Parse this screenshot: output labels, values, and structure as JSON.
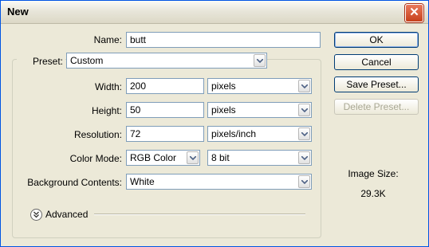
{
  "window": {
    "title": "New",
    "close_glyph": "✕"
  },
  "form": {
    "name": {
      "label": "Name:",
      "value": "butt"
    },
    "preset": {
      "label": "Preset:",
      "value": "Custom"
    },
    "width": {
      "label": "Width:",
      "value": "200",
      "unit": "pixels"
    },
    "height": {
      "label": "Height:",
      "value": "50",
      "unit": "pixels"
    },
    "resolution": {
      "label": "Resolution:",
      "value": "72",
      "unit": "pixels/inch"
    },
    "color_mode": {
      "label": "Color Mode:",
      "value": "RGB Color",
      "depth": "8 bit"
    },
    "background": {
      "label": "Background Contents:",
      "value": "White"
    },
    "advanced": {
      "label": "Advanced"
    }
  },
  "buttons": {
    "ok": "OK",
    "cancel": "Cancel",
    "save_preset": "Save Preset...",
    "delete_preset": "Delete Preset..."
  },
  "image_size": {
    "label": "Image Size:",
    "value": "29.3K"
  },
  "icons": {
    "dropdown": "chevron-down-icon",
    "advanced": "double-chevron-down-icon",
    "close": "close-icon"
  }
}
